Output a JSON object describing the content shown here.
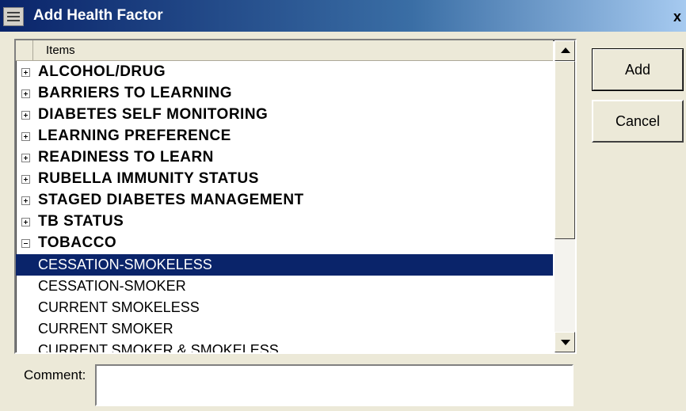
{
  "window": {
    "title": "Add Health Factor",
    "close_glyph": "x"
  },
  "list": {
    "column_header": "Items",
    "categories": [
      {
        "label": "ALCOHOL/DRUG",
        "expanded": false
      },
      {
        "label": "BARRIERS TO LEARNING",
        "expanded": false
      },
      {
        "label": "DIABETES SELF MONITORING",
        "expanded": false
      },
      {
        "label": "LEARNING PREFERENCE",
        "expanded": false
      },
      {
        "label": "READINESS TO LEARN",
        "expanded": false
      },
      {
        "label": "RUBELLA IMMUNITY STATUS",
        "expanded": false
      },
      {
        "label": "STAGED DIABETES MANAGEMENT",
        "expanded": false
      },
      {
        "label": "TB STATUS",
        "expanded": false
      },
      {
        "label": "TOBACCO",
        "expanded": true
      }
    ],
    "tobacco_items": [
      {
        "label": "CESSATION-SMOKELESS",
        "selected": true
      },
      {
        "label": "CESSATION-SMOKER",
        "selected": false
      },
      {
        "label": "CURRENT SMOKELESS",
        "selected": false
      },
      {
        "label": "CURRENT SMOKER",
        "selected": false
      },
      {
        "label": "CURRENT SMOKER & SMOKELESS",
        "selected": false
      }
    ],
    "selection_color": "#0a246a"
  },
  "buttons": {
    "add_label": "Add",
    "cancel_label": "Cancel"
  },
  "comment": {
    "label": "Comment:",
    "value": ""
  },
  "icons": {
    "window": "form-icon",
    "expand": "plus-box-icon",
    "collapse": "minus-box-icon",
    "scroll_up": "scroll-up-arrow-icon",
    "scroll_down": "scroll-down-arrow-icon"
  },
  "colors": {
    "titlebar_start": "#0a246a",
    "titlebar_end": "#a6caf0",
    "dialog_bg": "#ece9d8"
  }
}
